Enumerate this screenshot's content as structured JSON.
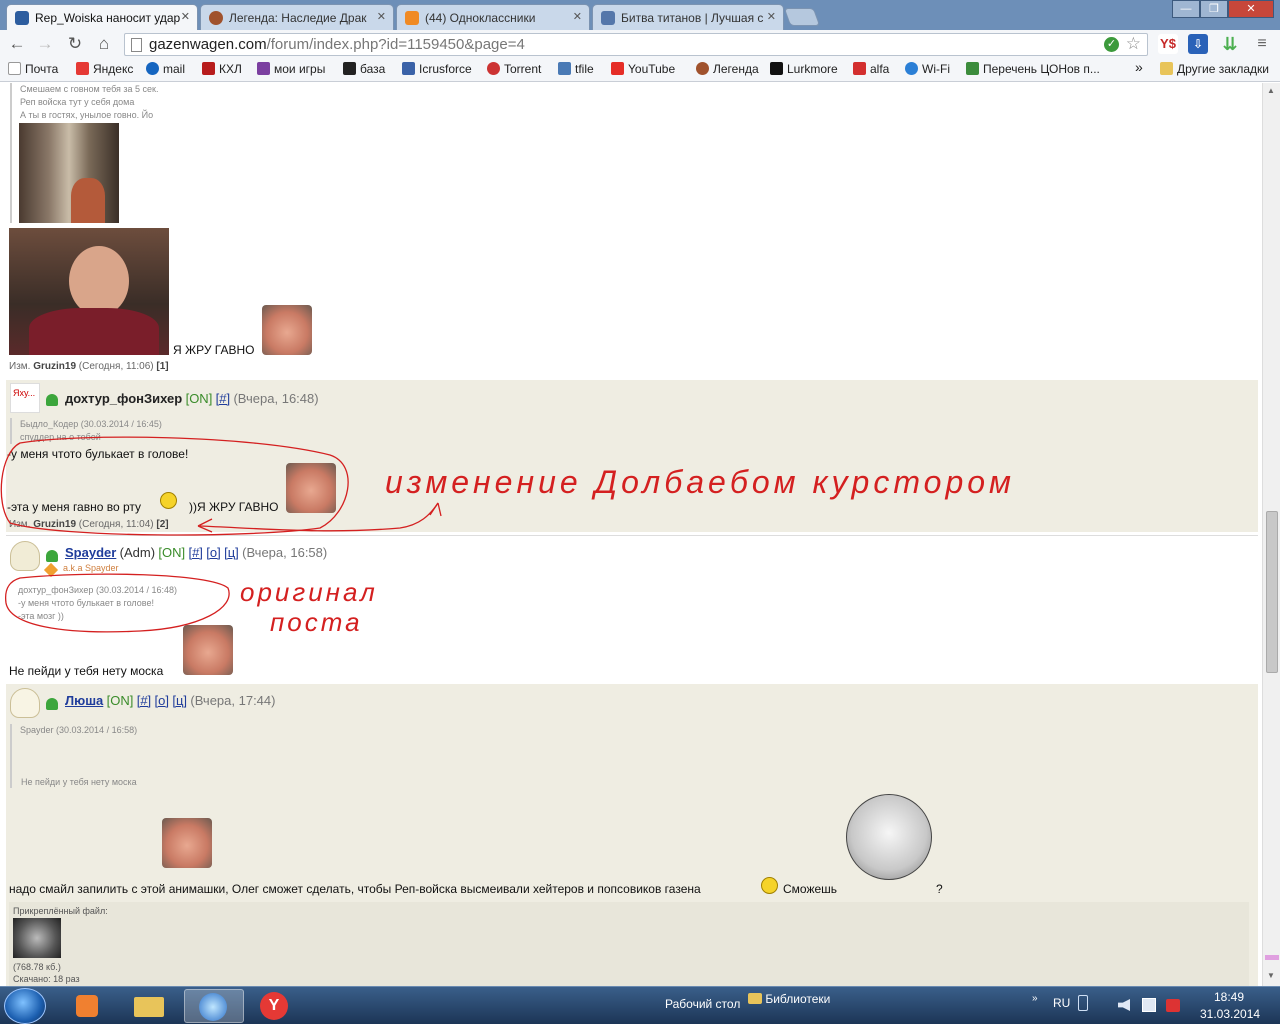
{
  "browser": {
    "tabs": [
      {
        "title": "Rep_Woiska наносит удар",
        "favicon_color": "#2d5d9f",
        "active": true
      },
      {
        "title": "Легенда: Наследие Драк",
        "favicon_color": "#a0522d",
        "active": false
      },
      {
        "title": "(44) Одноклассники",
        "favicon_color": "#f08a24",
        "active": false
      },
      {
        "title": "Битва титанов | Лучшая с",
        "favicon_color": "#5577aa",
        "active": false
      }
    ],
    "close_glyph": "✕",
    "window_buttons": {
      "minimize": "—",
      "maximize": "❐",
      "close": "✕"
    },
    "nav": {
      "back": "←",
      "forward": "→",
      "reload": "↻",
      "home": "⌂"
    },
    "url_host": "gazenwagen.com",
    "url_path": "/forum/index.php?id=1159450&page=4",
    "ok_glyph": "✓",
    "star_glyph": "☆",
    "extensions": [
      {
        "label": "Y$",
        "color": "#c62828"
      },
      {
        "label": "⇩",
        "color": "#2a62b8"
      },
      {
        "label": "⇊",
        "color": "#4caf50"
      },
      {
        "label": "≡",
        "color": "#888"
      }
    ],
    "bookmarks": [
      {
        "label": "Почта",
        "color": "#dddddd"
      },
      {
        "label": "Яндекс",
        "color": "#e53935"
      },
      {
        "label": "mail",
        "color": "#1565c0"
      },
      {
        "label": "КХЛ",
        "color": "#b71c1c"
      },
      {
        "label": "мои игры",
        "color": "#7b3fa0"
      },
      {
        "label": "база",
        "color": "#222222"
      },
      {
        "label": "Icrusforce",
        "color": "#3a62a8"
      },
      {
        "label": "Torrent",
        "color": "#cc3333"
      },
      {
        "label": "tfile",
        "color": "#4a7ab5"
      },
      {
        "label": "YouTube",
        "color": "#e52d27"
      },
      {
        "label": "Легенда",
        "color": "#a0522d"
      },
      {
        "label": "Lurkmore",
        "color": "#111111"
      },
      {
        "label": "alfa",
        "color": "#d32f2f"
      },
      {
        "label": "Wi-Fi",
        "color": "#2b7fd6"
      },
      {
        "label": "Перечень ЦОНов п...",
        "color": "#3c8c3c"
      }
    ],
    "bookmarks_more": "»",
    "other_bookmarks": "Другие закладки"
  },
  "forum": {
    "post0": {
      "quote_lines": [
        "Смешаем с говном тебя за 5 сек.",
        "Реп войска тут у себя дома",
        "А ты в гостях, унылое говно. Йо"
      ],
      "text": "Я ЖРУ ГАВНО",
      "edit_label": "Изм.",
      "edit_user": "Gruzin19",
      "edit_time": "(Сегодня, 11:06)",
      "edit_count": "[1]"
    },
    "post1": {
      "avatar_text": "Яху...",
      "username": "дохтур_фонЗихер",
      "status": "[ON]",
      "link_hash": "[#]",
      "date": "(Вчера, 16:48)",
      "quote_author": "Быдло_Кодер (30.03.2014 / 16:45)",
      "quote_text": "спуддер на о тобой",
      "line1": "-у меня чтото булькает в голове!",
      "line2": "-эта у меня гавно во рту",
      "line2_tail": "))Я ЖРУ ГАВНО",
      "edit_label": "Изм.",
      "edit_user": "Gruzin19",
      "edit_time": "(Сегодня, 11:04)",
      "edit_count": "[2]"
    },
    "post2": {
      "username": "Spayder",
      "role": "(Adm)",
      "status": "[ON]",
      "link_hash": "[#]",
      "link_o": "[о]",
      "link_c": "[ц]",
      "date": "(Вчера, 16:58)",
      "aka": "a.k.a Spayder",
      "quote_author": "дохтур_фонЗихер (30.03.2014 / 16:48)",
      "quote_line1": "-у меня чтото булькает в голове!",
      "quote_line2": "-эта мозг ))",
      "text": "Не пейди у тебя нету моска"
    },
    "post3": {
      "username": "Люша",
      "status": "[ON]",
      "link_hash": "[#]",
      "link_o": "[о]",
      "link_c": "[ц]",
      "date": "(Вчера, 17:44)",
      "quote_author": "Spayder (30.03.2014 / 16:58)",
      "quote_text": "Не пейди у тебя нету моска",
      "text": "надо смайл запилить с этой анимашки, Олег сможет сделать, чтобы Реп-войска высмеивали хейтеров и попсовиков газена",
      "text_tail": "Сможешь",
      "question": "?",
      "attach_label": "Прикреплённый файл:",
      "attach_size": "(768.78 кб.)",
      "attach_downloads": "Скачано: 18 раз"
    },
    "annotations": {
      "edited_by": "изменение Долбаебом курстором",
      "original_line1": "оригинал",
      "original_line2": "поста"
    }
  },
  "taskbar": {
    "desktop_label": "Рабочий стол",
    "libraries_label": "Библиотеки",
    "language": "RU",
    "time": "18:49",
    "date": "31.03.2014"
  }
}
